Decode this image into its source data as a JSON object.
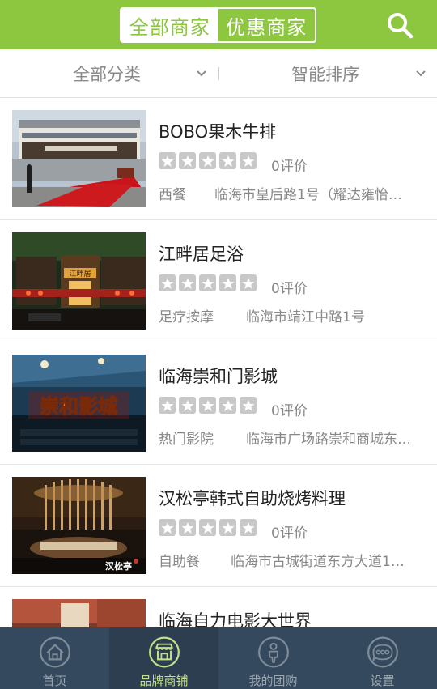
{
  "header": {
    "tab_all": "全部商家",
    "tab_discount": "优惠商家",
    "search_icon": "search-icon"
  },
  "filter": {
    "category": "全部分类",
    "sort": "智能排序"
  },
  "merchants": [
    {
      "name": "BOBO果木牛排",
      "rating_text": "0评价",
      "rating": 0,
      "category": "西餐",
      "address": "临海市皇后路1号（耀达雍怡…"
    },
    {
      "name": "江畔居足浴",
      "rating_text": "0评价",
      "rating": 0,
      "category": "足疗按摩",
      "address": "临海市靖江中路1号"
    },
    {
      "name": "临海崇和门影城",
      "rating_text": "0评价",
      "rating": 0,
      "category": "热门影院",
      "address": "临海市广场路崇和商城东…"
    },
    {
      "name": "汉松亭韩式自助烧烤料理",
      "rating_text": "0评价",
      "rating": 0,
      "category": "自助餐",
      "address": "临海市古城街道东方大道1…"
    },
    {
      "name": "临海自力电影大世界",
      "rating_text": "",
      "rating": 0,
      "category": "",
      "address": ""
    }
  ],
  "thumb_texts": {
    "jiangpan_sign": "江畔居",
    "chonghe_sign": "崇和影城",
    "hansong_sign": "汉松亭"
  },
  "tabbar": {
    "home": "首页",
    "brand": "品牌商铺",
    "groupbuy": "我的团购",
    "settings": "设置"
  },
  "colors": {
    "brand_green": "#8dc63f",
    "nav_bg": "#34495e",
    "nav_active_bg": "#2c3e50",
    "nav_active_label": "#c5e08a"
  }
}
